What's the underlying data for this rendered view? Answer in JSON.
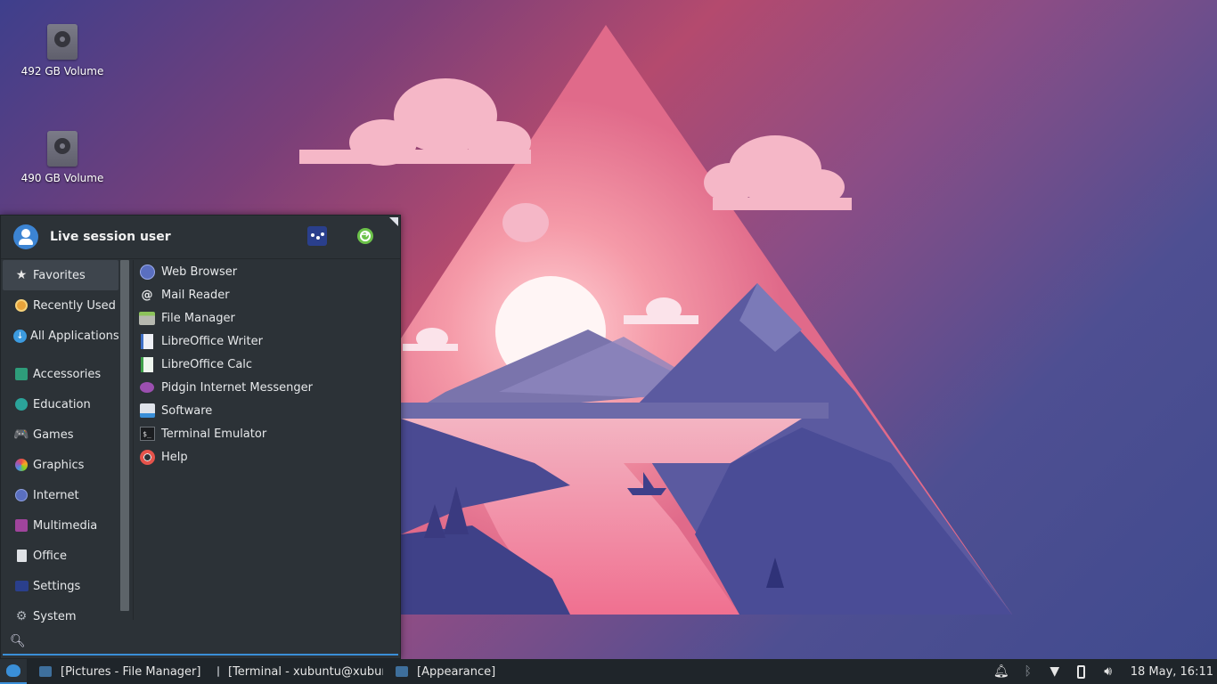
{
  "desktop": {
    "icons": [
      {
        "label": "492 GB Volume",
        "icon": "drive-harddisk-icon"
      },
      {
        "label": "490 GB Volume",
        "icon": "drive-harddisk-icon"
      }
    ]
  },
  "menu": {
    "user_name": "Live session user",
    "header_buttons": [
      {
        "name": "settings-manager",
        "icon": "settings-icon"
      },
      {
        "name": "log-out",
        "icon": "log-out-icon"
      }
    ],
    "categories_top": [
      {
        "label": "Favorites",
        "icon": "star-icon",
        "active": true
      },
      {
        "label": "Recently Used",
        "icon": "clock-icon"
      },
      {
        "label": "All Applications",
        "icon": "download-icon"
      }
    ],
    "categories": [
      {
        "label": "Accessories",
        "icon": "accessories-icon"
      },
      {
        "label": "Education",
        "icon": "education-icon"
      },
      {
        "label": "Games",
        "icon": "gamepad-icon"
      },
      {
        "label": "Graphics",
        "icon": "graphics-icon"
      },
      {
        "label": "Internet",
        "icon": "globe-icon"
      },
      {
        "label": "Multimedia",
        "icon": "multimedia-icon"
      },
      {
        "label": "Office",
        "icon": "document-icon"
      },
      {
        "label": "Settings",
        "icon": "settings-icon"
      },
      {
        "label": "System",
        "icon": "gear-icon"
      }
    ],
    "apps": [
      {
        "label": "Web Browser",
        "icon": "web-browser-icon"
      },
      {
        "label": "Mail Reader",
        "icon": "at-sign-icon"
      },
      {
        "label": "File Manager",
        "icon": "folder-icon"
      },
      {
        "label": "LibreOffice Writer",
        "icon": "writer-icon"
      },
      {
        "label": "LibreOffice Calc",
        "icon": "calc-icon"
      },
      {
        "label": "Pidgin Internet Messenger",
        "icon": "pidgin-icon"
      },
      {
        "label": "Software",
        "icon": "software-icon"
      },
      {
        "label": "Terminal Emulator",
        "icon": "terminal-icon"
      },
      {
        "label": "Help",
        "icon": "lifebuoy-icon"
      }
    ],
    "search": {
      "value": "",
      "placeholder": ""
    }
  },
  "taskbar": {
    "tasks": [
      {
        "label": "[Pictures - File Manager]",
        "icon": "folder-icon"
      },
      {
        "label": "[Terminal - xubuntu@xubunt...",
        "icon": "terminal-icon"
      },
      {
        "label": "[Appearance]",
        "icon": "appearance-icon"
      }
    ],
    "tray": [
      "notifications-icon",
      "bluetooth-icon",
      "wifi-icon",
      "battery-icon",
      "volume-icon"
    ],
    "clock": "18 May, 16:11"
  },
  "colors": {
    "menu_bg": "#2c3237",
    "accent": "#3a8fd8",
    "panel_bg": "#1f252a"
  }
}
